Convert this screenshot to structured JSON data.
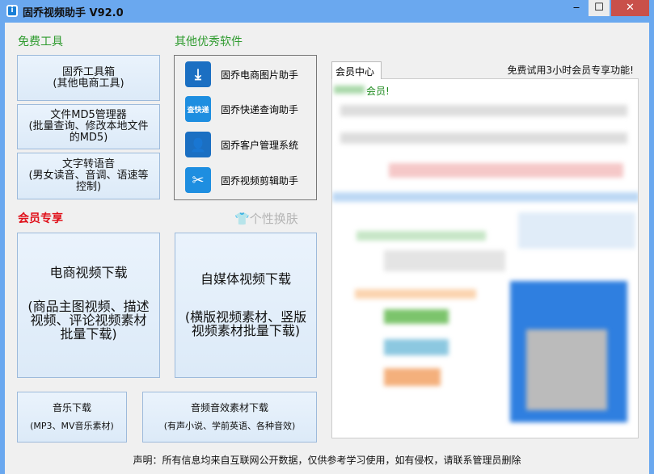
{
  "window": {
    "title": "固乔视频助手 V92.0",
    "min": "‒",
    "max": "☐",
    "close": "✕"
  },
  "free_tools": {
    "heading": "免费工具",
    "buttons": [
      {
        "l1": "固乔工具箱",
        "l2": "(其他电商工具)"
      },
      {
        "l1": "文件MD5管理器",
        "l2": "(批量查询、修改本地文件",
        "l3": "的MD5)"
      },
      {
        "l1": "文字转语音",
        "l2": "(男女读音、音调、语速等",
        "l3": "控制)"
      }
    ]
  },
  "other_software": {
    "heading": "其他优秀软件",
    "items": [
      {
        "label": "固乔电商图片助手",
        "icon": "⤓"
      },
      {
        "label": "固乔快递查询助手",
        "icon": "查快递"
      },
      {
        "label": "固乔客户管理系统",
        "icon": "👤"
      },
      {
        "label": "固乔视频剪辑助手",
        "icon": "✂"
      }
    ]
  },
  "vip": {
    "heading": "会员专享",
    "skin": "个性换肤",
    "skin_icon": "👕",
    "ecom": {
      "title": "电商视频下载",
      "desc": "(商品主图视频、描述视频、评论视频素材批量下载)"
    },
    "media": {
      "title": "自媒体视频下载",
      "desc": "(横版视频素材、竖版视频素材批量下载)"
    },
    "music": {
      "title": "音乐下载",
      "desc": "(MP3、MV音乐素材)"
    },
    "audio": {
      "title": "音频音效素材下载",
      "desc": "(有声小说、学前英语、各种音效)"
    }
  },
  "member_center": {
    "tab": "会员中心",
    "trial": "免费试用3小时会员专享功能!",
    "greeting": "会员!"
  },
  "footer": "声明：所有信息均来自互联网公开数据，仅供参考学习使用，如有侵权，请联系管理员删除"
}
